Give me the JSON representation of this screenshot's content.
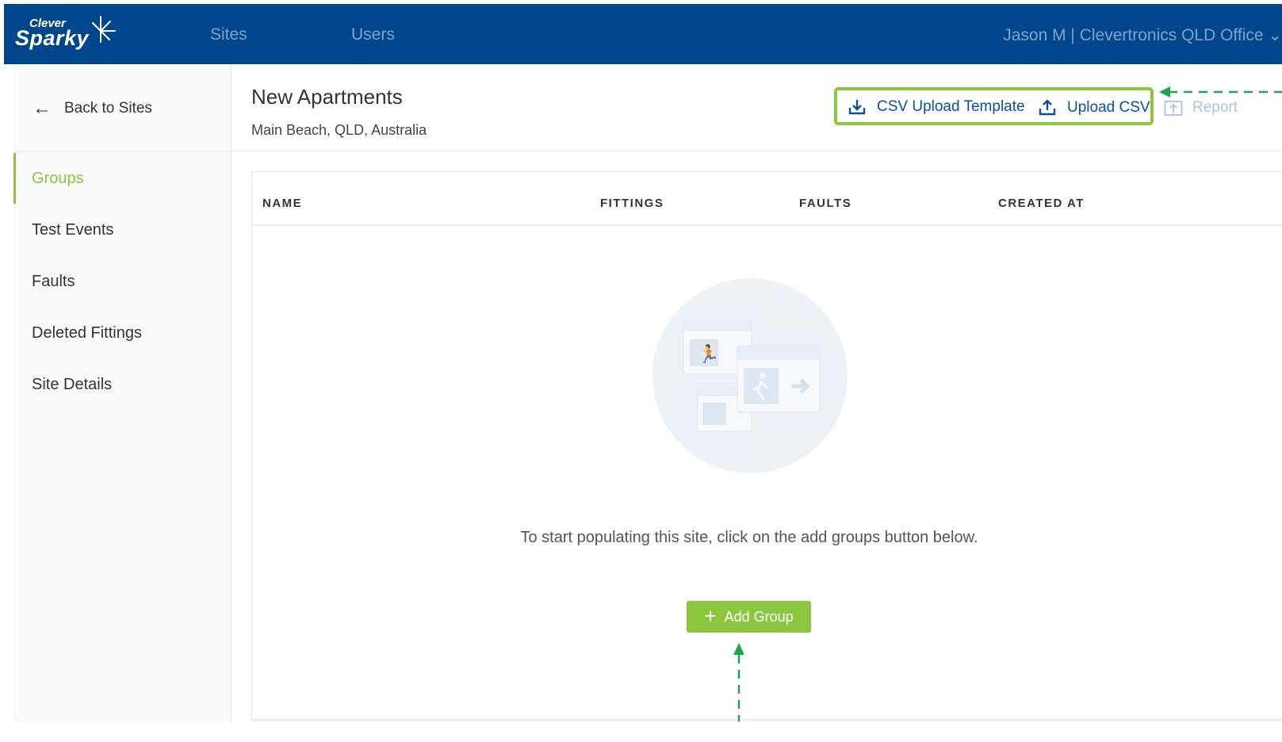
{
  "brand": {
    "logo_top": "Clever",
    "logo_main": "Sparky"
  },
  "nav": {
    "sites": "Sites",
    "users": "Users",
    "user_menu": "Jason M | Clevertronics QLD Office ⌄"
  },
  "sidebar": {
    "back_label": "Back to Sites",
    "items": [
      {
        "label": "Groups",
        "active": true
      },
      {
        "label": "Test Events"
      },
      {
        "label": "Faults"
      },
      {
        "label": "Deleted Fittings"
      },
      {
        "label": "Site Details"
      }
    ]
  },
  "page": {
    "title": "New Apartments",
    "subtitle": "Main Beach, QLD, Australia"
  },
  "actions": {
    "csv_template": "CSV Upload Template",
    "upload_csv": "Upload CSV",
    "report": "Report"
  },
  "table": {
    "columns": [
      "NAME",
      "FITTINGS",
      "FAULTS",
      "CREATED AT"
    ]
  },
  "empty_state": {
    "message": "To start populating this site, click on the add groups button below.",
    "button": "Add Group"
  },
  "colors": {
    "header_bg": "#00468c",
    "accent_green": "#8cc63f",
    "link_blue": "#0b4f9c",
    "annotation_green": "#1aa84a"
  }
}
